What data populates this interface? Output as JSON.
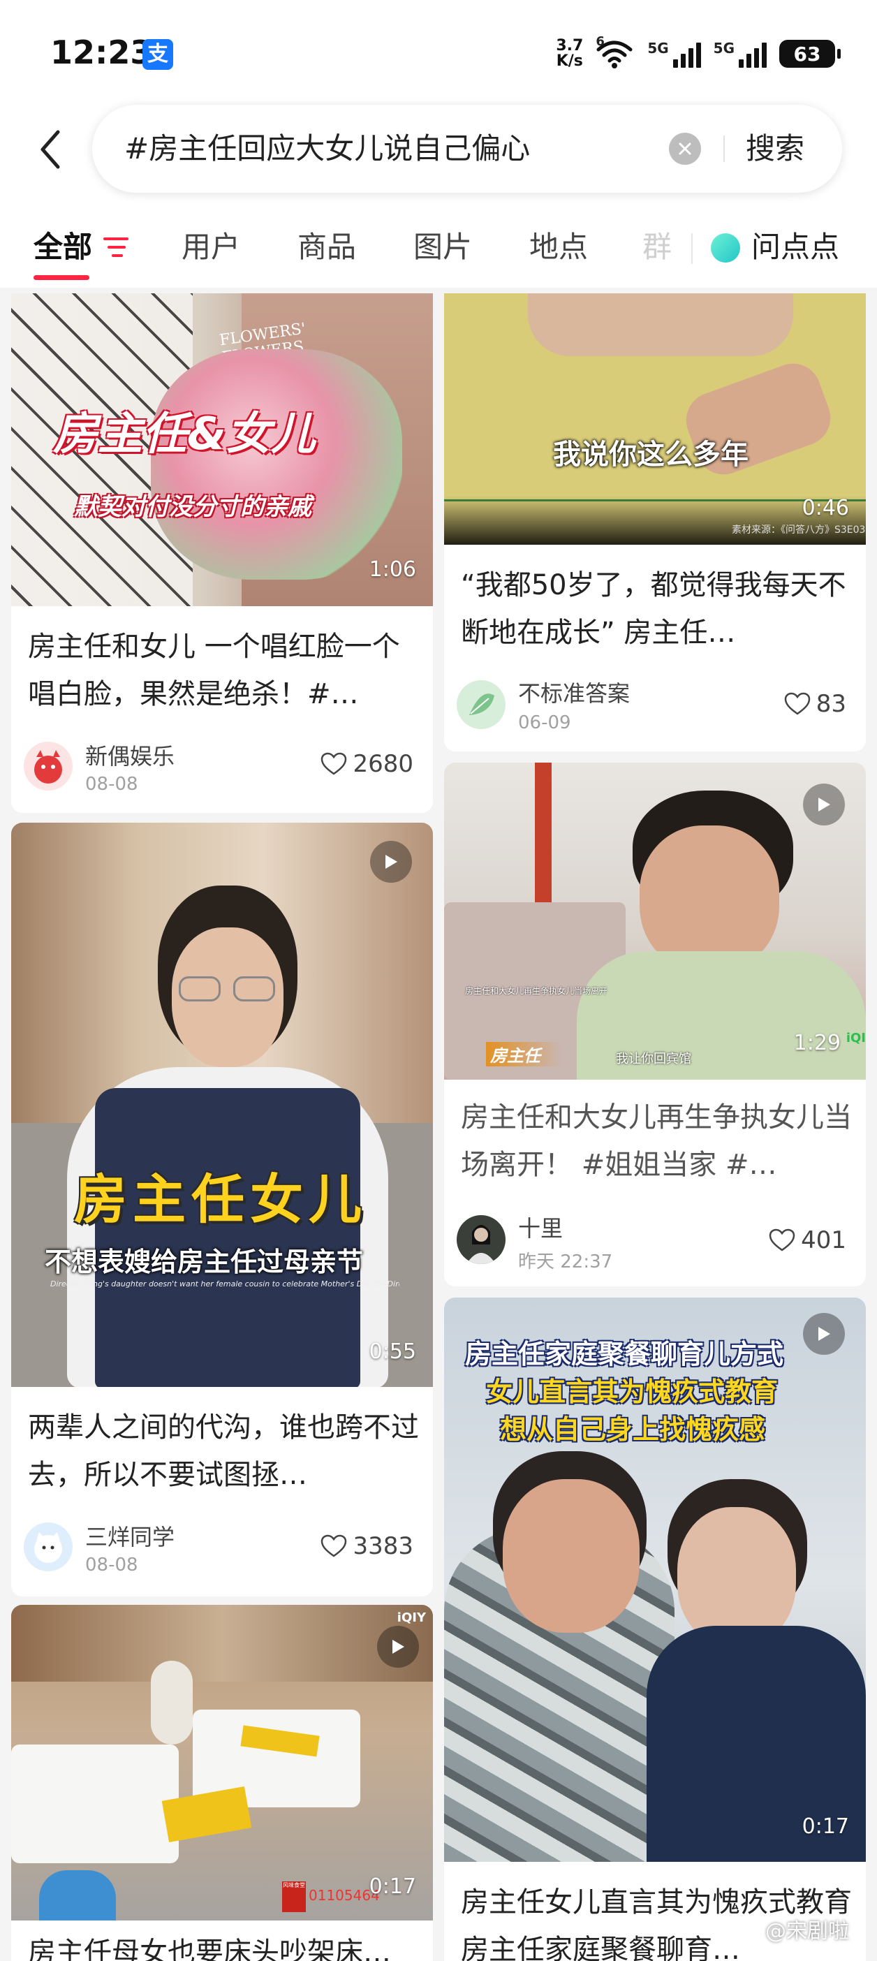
{
  "status_bar": {
    "time": "12:23",
    "app_badge": "支",
    "net_speed_value": "3.7",
    "net_speed_unit": "K/s",
    "wifi_badge": "6",
    "signal1": "5G",
    "signal2": "5G",
    "battery": "63"
  },
  "search": {
    "query": "#房主任回应大女儿说自己偏心",
    "button": "搜索"
  },
  "tabs": [
    {
      "label": "全部"
    },
    {
      "label": "用户"
    },
    {
      "label": "商品"
    },
    {
      "label": "图片"
    },
    {
      "label": "地点"
    },
    {
      "label": "群"
    }
  ],
  "qa_label": "问点点",
  "cards": {
    "c1": {
      "overlay_title": "房主任&女儿",
      "overlay_sub": "默契对付没分寸的亲戚",
      "bouquet_text": "FLOWERS' FLOWERS",
      "duration": "1:06",
      "title": "房主任和女儿 一个唱红脸一个唱白脸，果然是绝杀！#…",
      "author": "新偶娱乐",
      "date": "08-08",
      "likes": "2680"
    },
    "c2": {
      "overlay_sub": "我说你这么多年",
      "source": "素材来源：《问答八方》S3E03",
      "duration": "0:46",
      "title": "“我都50岁了，都觉得我每天不断地在成长” 房主任…",
      "author": "不标准答案",
      "date": "06-09",
      "likes": "83"
    },
    "c3": {
      "overlay_title": "房主任女儿",
      "overlay_sub": "不想表嫂给房主任过母亲节",
      "overlay_en": "Director Fang's daughter doesn't want her female cousin to celebrate Mother's Day for Director Fang",
      "duration": "0:55",
      "title": "两辈人之间的代沟，谁也跨不过去，所以不要试图拯…",
      "author": "三烊同学",
      "date": "08-08",
      "likes": "3383"
    },
    "c4": {
      "overlay_top": "房主任和大女儿再生争执女儿当场离开",
      "overlay_badge": "房主任",
      "overlay_sub": "我让你回宾馆",
      "corner": "iQI",
      "duration": "1:29",
      "title": "房主任和大女儿再生争执女儿当场离开！ #姐姐当家 #…",
      "author": "十里",
      "date": "昨天 22:37",
      "likes": "401"
    },
    "c5": {
      "corner": "iQIY",
      "stamp": "风味食堂",
      "number": "01105464",
      "duration": "0:17",
      "title": "房主任母女也要床头吵架床…"
    },
    "c6": {
      "overlay_line1": "房主任家庭聚餐聊育儿方式",
      "overlay_line2": "女儿直言其为愧疚式教育",
      "overlay_line3": "想从自己身上找愧疚感",
      "duration": "0:17",
      "title": "房主任女儿直言其为愧疚式教育 房主任家庭聚餐聊育…"
    }
  },
  "watermark": "@宋剧啦"
}
